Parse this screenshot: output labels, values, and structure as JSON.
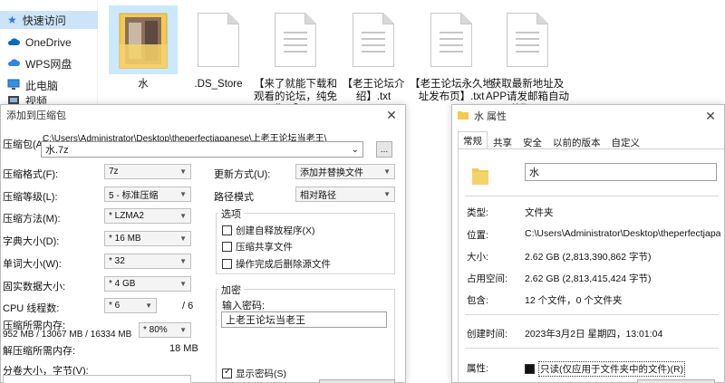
{
  "nav": {
    "items": [
      {
        "label": "快速访问",
        "icon": "star-icon"
      },
      {
        "label": "OneDrive",
        "icon": "cloud-icon"
      },
      {
        "label": "WPS网盘",
        "icon": "cloud-icon"
      },
      {
        "label": "此电脑",
        "icon": "computer-icon"
      },
      {
        "label": "视频",
        "icon": "video-icon"
      }
    ]
  },
  "files": [
    {
      "name": "水",
      "icon": "folder-thumbnail-icon"
    },
    {
      "name": ".DS_Store",
      "icon": "file-icon"
    },
    {
      "name": "【来了就能下载和观看的论坛，纯免费！】.txt",
      "icon": "text-file-icon"
    },
    {
      "name": "【老王论坛介绍】.txt",
      "icon": "text-file-icon"
    },
    {
      "name": "【老王论坛永久地址发布页】.txt",
      "icon": "text-file-icon"
    },
    {
      "name": "获取最新地址及APP请发邮箱自动获取.txt",
      "icon": "text-file-icon"
    }
  ],
  "zip": {
    "title": "添加到压缩包",
    "archive_label": "压缩包(A)",
    "archive_path": "C:\\Users\\Administrator\\Desktop\\theperfectjapanese\\上老王论坛当老王\\",
    "archive_name": "水.7z",
    "browse": "...",
    "format_label": "压缩格式(F):",
    "format_value": "7z",
    "level_label": "压缩等级(L):",
    "level_value": "5 - 标准压缩",
    "method_label": "压缩方法(M):",
    "method_value": "* LZMA2",
    "dict_label": "字典大小(D):",
    "dict_value": "* 16 MB",
    "word_label": "单词大小(W):",
    "word_value": "* 32",
    "solid_label": "固实数据大小:",
    "solid_value": "* 4 GB",
    "cpu_label": "CPU 线程数:",
    "cpu_value": "* 6",
    "cpu_max": "/ 6",
    "mem_label": "压缩所需内存:",
    "mem_detail": "952 MB / 13067 MB / 16334 MB",
    "mem_value": "* 80%",
    "decomp_label": "解压缩所需内存:",
    "decomp_value": "18 MB",
    "split_label": "分卷大小，字节(V):",
    "update_label": "更新方式(U):",
    "update_value": "添加并替换文件",
    "path_label": "路径模式",
    "path_value": "相对路径",
    "options_title": "选项",
    "opt_sfx": "创建自释放程序(X)",
    "opt_shared": "压缩共享文件",
    "opt_delete": "操作完成后删除源文件",
    "encrypt_title": "加密",
    "password_label": "输入密码:",
    "password_value": "上老王论坛当老王",
    "show_password": "显示密码(S)"
  },
  "props": {
    "title": "水 属性",
    "tabs": [
      "常规",
      "共享",
      "安全",
      "以前的版本",
      "自定义"
    ],
    "name_value": "水",
    "type_label": "类型:",
    "type_value": "文件夹",
    "location_label": "位置:",
    "location_value": "C:\\Users\\Administrator\\Desktop\\theperfectjapanese",
    "size_label": "大小:",
    "size_value": "2.62 GB (2,813,390,862 字节)",
    "disk_label": "占用空间:",
    "disk_value": "2.62 GB (2,813,415,424 字节)",
    "contains_label": "包含:",
    "contains_value": "12 个文件，0 个文件夹",
    "created_label": "创建时间:",
    "created_value": "2023年3月2日 星期四，13:01:04",
    "attr_label": "属性:",
    "attr_readonly": "只读(仅应用于文件夹中的文件)(R)"
  },
  "colors": {
    "selection": "#cce4f7",
    "folder": "#f3c94f",
    "accent": "#0078d4"
  }
}
